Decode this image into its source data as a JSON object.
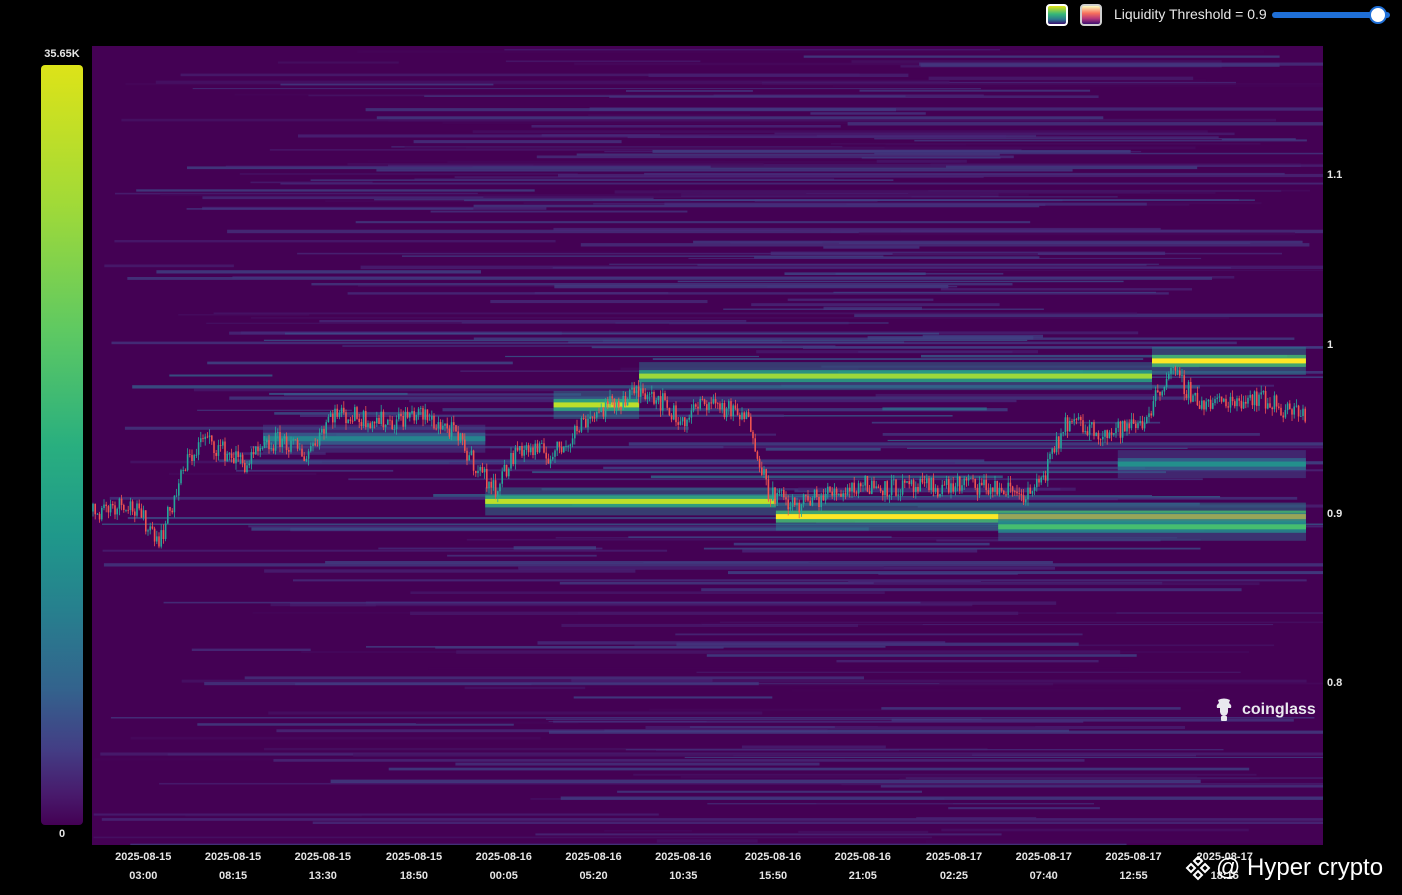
{
  "toolbar": {
    "palette_a_icon": "viridis-palette-swatch",
    "palette_b_icon": "magma-palette-swatch",
    "threshold_label": "Liquidity Threshold = 0.9",
    "threshold_value": 0.9
  },
  "colorbar": {
    "max_label": "35.65K",
    "min_label": "0"
  },
  "watermark": {
    "text": "coinglass",
    "icon": "coinglass-logo-icon"
  },
  "footer": {
    "text": "@ Hyper crypto",
    "icon": "binance-square-icon"
  },
  "chart_data": {
    "type": "heatmap",
    "title": "",
    "xlabel": "",
    "ylabel": "",
    "ylim": [
      0.705,
      1.177
    ],
    "yticks": [
      1.1,
      1,
      0.9,
      0.8
    ],
    "ytick_labels": [
      "1.1",
      "1",
      "0.9",
      "0.8"
    ],
    "x_ticks": [
      {
        "date": "2025-08-15",
        "time": "03:00"
      },
      {
        "date": "2025-08-15",
        "time": "08:15"
      },
      {
        "date": "2025-08-15",
        "time": "13:30"
      },
      {
        "date": "2025-08-15",
        "time": "18:50"
      },
      {
        "date": "2025-08-16",
        "time": "00:05"
      },
      {
        "date": "2025-08-16",
        "time": "05:20"
      },
      {
        "date": "2025-08-16",
        "time": "10:35"
      },
      {
        "date": "2025-08-16",
        "time": "15:50"
      },
      {
        "date": "2025-08-16",
        "time": "21:05"
      },
      {
        "date": "2025-08-17",
        "time": "02:25"
      },
      {
        "date": "2025-08-17",
        "time": "07:40"
      },
      {
        "date": "2025-08-17",
        "time": "12:55"
      },
      {
        "date": "2025-08-17",
        "time": "18:15"
      }
    ],
    "colorscale": "viridis",
    "colorbar_range": [
      0,
      35650
    ],
    "background_color": "#440154",
    "up_color": "#26a69a",
    "down_color": "#ef5350",
    "liquidity_bands": [
      {
        "price": 0.965,
        "t_start": "2025-08-16 03:00",
        "t_end": "2025-08-16 08:00",
        "intensity": 0.9
      },
      {
        "price": 0.982,
        "t_start": "2025-08-16 08:00",
        "t_end": "2025-08-17 14:00",
        "intensity": 0.85
      },
      {
        "price": 0.991,
        "t_start": "2025-08-17 14:00",
        "t_end": "2025-08-17 23:00",
        "intensity": 1.0
      },
      {
        "price": 0.908,
        "t_start": "2025-08-15 23:00",
        "t_end": "2025-08-16 16:00",
        "intensity": 0.9
      },
      {
        "price": 0.899,
        "t_start": "2025-08-16 16:00",
        "t_end": "2025-08-17 23:00",
        "intensity": 1.0
      },
      {
        "price": 0.893,
        "t_start": "2025-08-17 05:00",
        "t_end": "2025-08-17 23:00",
        "intensity": 0.7
      },
      {
        "price": 0.945,
        "t_start": "2025-08-15 10:00",
        "t_end": "2025-08-15 23:00",
        "intensity": 0.45
      },
      {
        "price": 0.93,
        "t_start": "2025-08-17 12:00",
        "t_end": "2025-08-17 23:00",
        "intensity": 0.5
      }
    ],
    "price_path": [
      {
        "t": "2025-08-15 00:00",
        "price": 0.902
      },
      {
        "t": "2025-08-15 02:00",
        "price": 0.908
      },
      {
        "t": "2025-08-15 04:00",
        "price": 0.886
      },
      {
        "t": "2025-08-15 05:30",
        "price": 0.93
      },
      {
        "t": "2025-08-15 06:30",
        "price": 0.945
      },
      {
        "t": "2025-08-15 09:00",
        "price": 0.93
      },
      {
        "t": "2025-08-15 11:00",
        "price": 0.945
      },
      {
        "t": "2025-08-15 12:30",
        "price": 0.935
      },
      {
        "t": "2025-08-15 14:00",
        "price": 0.96
      },
      {
        "t": "2025-08-15 17:30",
        "price": 0.955
      },
      {
        "t": "2025-08-15 19:00",
        "price": 0.96
      },
      {
        "t": "2025-08-15 21:00",
        "price": 0.95
      },
      {
        "t": "2025-08-15 23:30",
        "price": 0.915
      },
      {
        "t": "2025-08-16 01:00",
        "price": 0.94
      },
      {
        "t": "2025-08-16 03:00",
        "price": 0.935
      },
      {
        "t": "2025-08-16 05:00",
        "price": 0.958
      },
      {
        "t": "2025-08-16 07:00",
        "price": 0.968
      },
      {
        "t": "2025-08-16 08:30",
        "price": 0.975
      },
      {
        "t": "2025-08-16 10:30",
        "price": 0.955
      },
      {
        "t": "2025-08-16 12:00",
        "price": 0.968
      },
      {
        "t": "2025-08-16 14:30",
        "price": 0.955
      },
      {
        "t": "2025-08-16 15:30",
        "price": 0.915
      },
      {
        "t": "2025-08-16 17:00",
        "price": 0.905
      },
      {
        "t": "2025-08-16 19:00",
        "price": 0.912
      },
      {
        "t": "2025-08-16 21:00",
        "price": 0.918
      },
      {
        "t": "2025-08-17 00:00",
        "price": 0.915
      },
      {
        "t": "2025-08-17 03:00",
        "price": 0.918
      },
      {
        "t": "2025-08-17 07:00",
        "price": 0.912
      },
      {
        "t": "2025-08-17 08:00",
        "price": 0.93
      },
      {
        "t": "2025-08-17 09:00",
        "price": 0.955
      },
      {
        "t": "2025-08-17 11:30",
        "price": 0.948
      },
      {
        "t": "2025-08-17 13:30",
        "price": 0.955
      },
      {
        "t": "2025-08-17 15:00",
        "price": 0.985
      },
      {
        "t": "2025-08-17 17:00",
        "price": 0.965
      },
      {
        "t": "2025-08-17 20:00",
        "price": 0.97
      },
      {
        "t": "2025-08-17 22:00",
        "price": 0.962
      },
      {
        "t": "2025-08-17 23:00",
        "price": 0.958
      }
    ]
  }
}
